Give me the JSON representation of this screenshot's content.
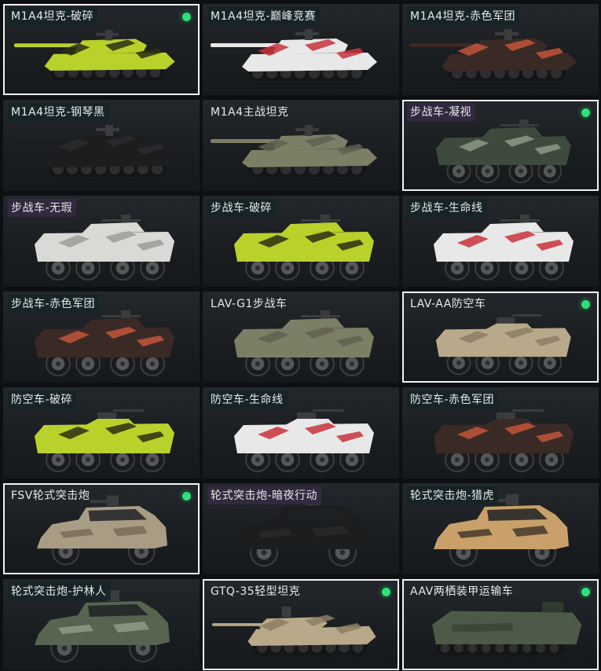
{
  "skins": [
    {
      "label": "M1A4坦克-破碎",
      "kind": "tank",
      "camo": "lime",
      "selected": true,
      "equipped": true,
      "label_style": "dark"
    },
    {
      "label": "M1A4坦克-巅峰竞赛",
      "kind": "tank",
      "camo": "redwhite",
      "selected": false,
      "equipped": false,
      "label_style": "dark"
    },
    {
      "label": "M1A4坦克-赤色军团",
      "kind": "tank",
      "camo": "redblack",
      "selected": false,
      "equipped": false,
      "label_style": "dark"
    },
    {
      "label": "M1A4坦克-钢琴黑",
      "kind": "tank",
      "camo": "black",
      "selected": false,
      "equipped": false,
      "label_style": "dark"
    },
    {
      "label": "M1A4主战坦克",
      "kind": "tank",
      "camo": "olive",
      "selected": false,
      "equipped": false,
      "label_style": "plain"
    },
    {
      "label": "步战车-凝视",
      "kind": "apc",
      "camo": "greencamo",
      "selected": true,
      "equipped": true,
      "label_style": "purple"
    },
    {
      "label": "步战车-无瑕",
      "kind": "apc",
      "camo": "white",
      "selected": false,
      "equipped": false,
      "label_style": "purple"
    },
    {
      "label": "步战车-破碎",
      "kind": "apc",
      "camo": "lime",
      "selected": false,
      "equipped": false,
      "label_style": "dark"
    },
    {
      "label": "步战车-生命线",
      "kind": "apc",
      "camo": "redwhite",
      "selected": false,
      "equipped": false,
      "label_style": "dark"
    },
    {
      "label": "步战车-赤色军团",
      "kind": "apc",
      "camo": "redblack",
      "selected": false,
      "equipped": false,
      "label_style": "dark"
    },
    {
      "label": "LAV-G1步战车",
      "kind": "apc",
      "camo": "olive",
      "selected": false,
      "equipped": false,
      "label_style": "plain"
    },
    {
      "label": "LAV-AA防空车",
      "kind": "aa",
      "camo": "sand",
      "selected": true,
      "equipped": true,
      "label_style": "plain"
    },
    {
      "label": "防空车-破碎",
      "kind": "aa",
      "camo": "lime",
      "selected": false,
      "equipped": false,
      "label_style": "dark"
    },
    {
      "label": "防空车-生命线",
      "kind": "aa",
      "camo": "redwhite",
      "selected": false,
      "equipped": false,
      "label_style": "dark"
    },
    {
      "label": "防空车-赤色军团",
      "kind": "aa",
      "camo": "redblack",
      "selected": false,
      "equipped": false,
      "label_style": "dark"
    },
    {
      "label": "FSV轮式突击炮",
      "kind": "jeep",
      "camo": "desert",
      "selected": true,
      "equipped": true,
      "label_style": "plain"
    },
    {
      "label": "轮式突击炮-暗夜行动",
      "kind": "jeep",
      "camo": "black",
      "selected": false,
      "equipped": false,
      "label_style": "purple"
    },
    {
      "label": "轮式突击炮-猎虎",
      "kind": "jeep",
      "camo": "tiger",
      "selected": false,
      "equipped": false,
      "label_style": "dark"
    },
    {
      "label": "轮式突击炮-护林人",
      "kind": "jeep",
      "camo": "forest",
      "selected": false,
      "equipped": false,
      "label_style": "dark"
    },
    {
      "label": "GTQ-35轻型坦克",
      "kind": "lighttank",
      "camo": "sand",
      "selected": true,
      "equipped": true,
      "label_style": "plain"
    },
    {
      "label": "AAV两栖装甲运输车",
      "kind": "amphib",
      "camo": "darkgreen",
      "selected": true,
      "equipped": true,
      "label_style": "plain"
    }
  ],
  "camo_colors": {
    "lime": [
      "#b9d12a",
      "#2b2f12"
    ],
    "redwhite": [
      "#e8e8e8",
      "#c8323a"
    ],
    "redblack": [
      "#3a2a26",
      "#c4553a"
    ],
    "black": [
      "#1c1d1f",
      "#2b2c2e"
    ],
    "olive": [
      "#7c7e66",
      "#5e6150"
    ],
    "greencamo": [
      "#3f4a3e",
      "#8a9a86"
    ],
    "white": [
      "#d9dad6",
      "#9a9c98"
    ],
    "sand": [
      "#b8a98a",
      "#8c7f65"
    ],
    "desert": [
      "#a89c84",
      "#6e6452"
    ],
    "tiger": [
      "#c9a06a",
      "#2a241e"
    ],
    "forest": [
      "#566450",
      "#9aa890"
    ],
    "darkgreen": [
      "#4e5a48",
      "#313a2e"
    ]
  },
  "status_colors": {
    "equipped": "#2ee07a",
    "selected_border": "#f2f2f2"
  }
}
